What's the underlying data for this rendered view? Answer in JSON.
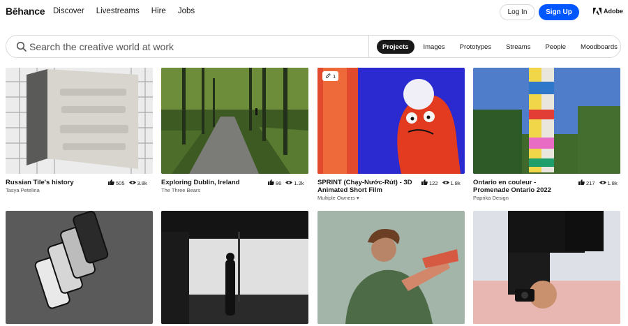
{
  "brand": {
    "logo": "Bēhance",
    "accent": "#0057ff"
  },
  "nav": {
    "links": [
      "Discover",
      "Livestreams",
      "Hire",
      "Jobs"
    ],
    "login": "Log In",
    "signup": "Sign Up",
    "adobe": "Adobe"
  },
  "search": {
    "placeholder": "Search the creative world at work",
    "filters": [
      "Projects",
      "Images",
      "Prototypes",
      "Streams",
      "People",
      "Moodboards"
    ],
    "active_filter": "Projects"
  },
  "projects": [
    {
      "title": "Russian Tile's history",
      "owner": "Tasya Petelina",
      "likes": "505",
      "views": "3.8k"
    },
    {
      "title": "Exploring Dublin, Ireland",
      "owner": "The Three Bears",
      "likes": "86",
      "views": "1.2k"
    },
    {
      "title": "SPRINT (Chạy-Nước-Rút) - 3D Animated Short Film",
      "owner": "Multiple Owners ▾",
      "likes": "122",
      "views": "1.8k",
      "badge_count": "1"
    },
    {
      "title": "Ontario en couleur - Promenade Ontario 2022",
      "owner": "Paprika Design",
      "likes": "217",
      "views": "1.8k"
    }
  ]
}
